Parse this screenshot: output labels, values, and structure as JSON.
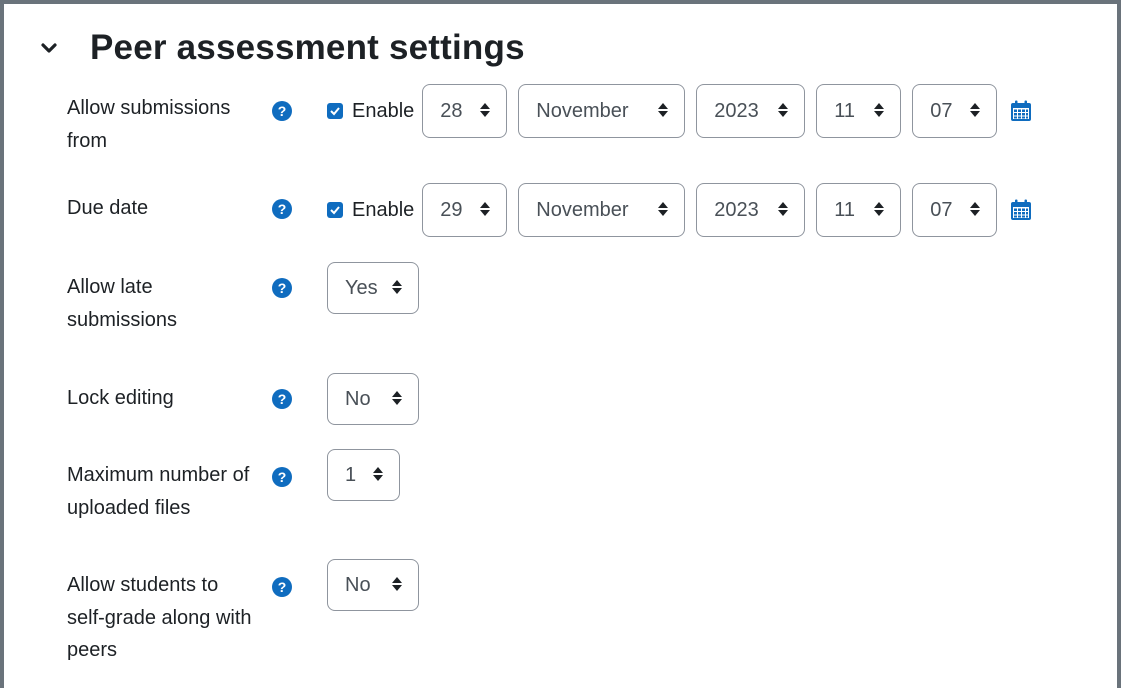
{
  "section": {
    "title": "Peer assessment settings",
    "chevron_icon": "chevron-down-icon"
  },
  "icons": {
    "help": "question-circle-icon",
    "calendar": "calendar-icon",
    "sort": "sort-arrows-icon",
    "checkbox": "checkbox-checked-icon"
  },
  "colors": {
    "accent": "#0f6cbf",
    "help": "#0f6cbf",
    "text": "#1d2125",
    "border": "#8f959e",
    "frame": "#6a737b"
  },
  "fields": {
    "submissions_from": {
      "label": "Allow submissions from",
      "enable_label": "Enable",
      "enabled": true,
      "day": "28",
      "month": "November",
      "year": "2023",
      "hour": "11",
      "minute": "07"
    },
    "due_date": {
      "label": "Due date",
      "enable_label": "Enable",
      "enabled": true,
      "day": "29",
      "month": "November",
      "year": "2023",
      "hour": "11",
      "minute": "07"
    },
    "late_submissions": {
      "label": "Allow late submissions",
      "value": "Yes"
    },
    "lock_editing": {
      "label": "Lock editing",
      "value": "No"
    },
    "max_files": {
      "label": "Maximum number of uploaded files",
      "value": "1"
    },
    "self_grade": {
      "label": "Allow students to self-grade along with peers",
      "value": "No"
    }
  }
}
